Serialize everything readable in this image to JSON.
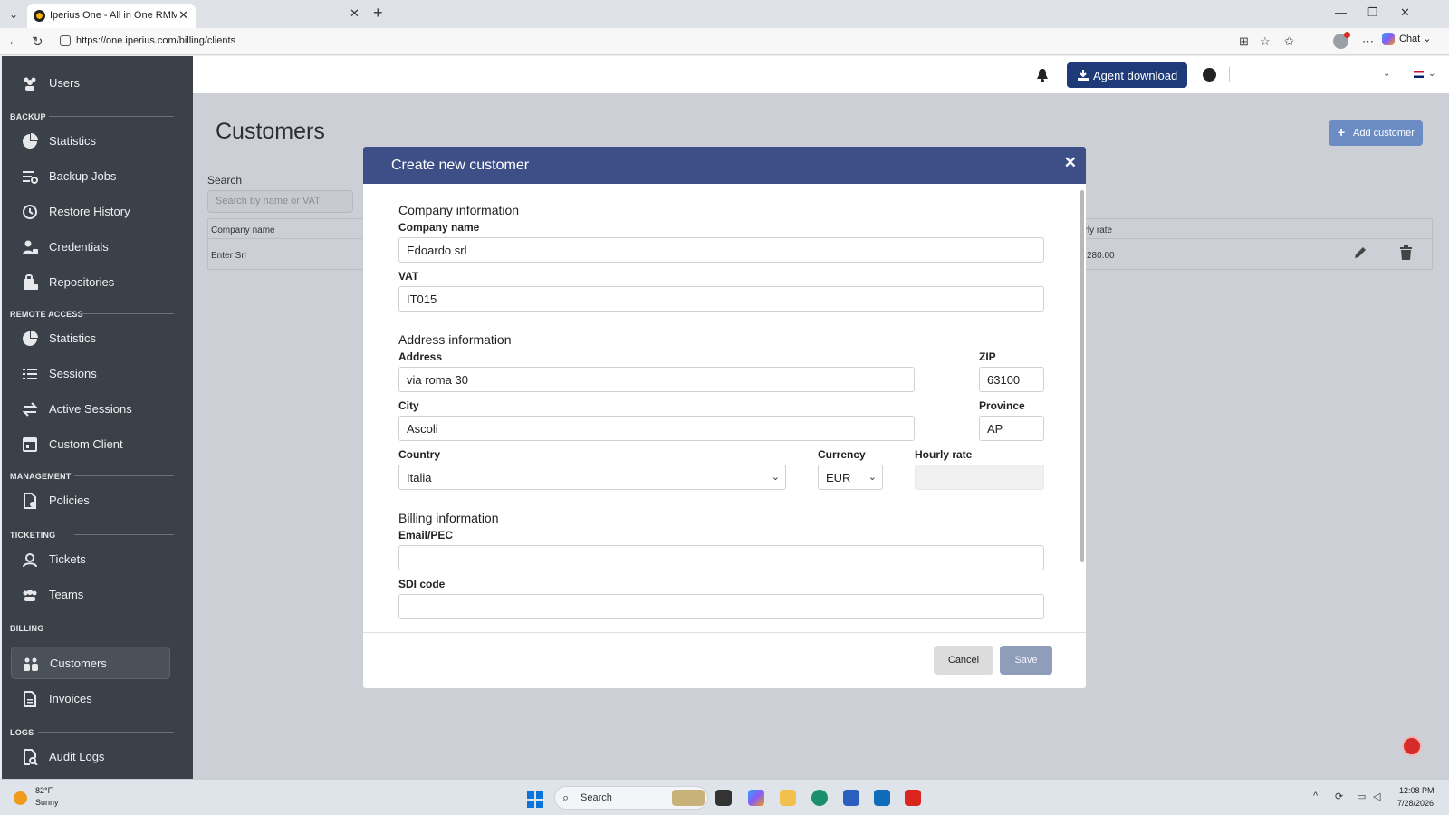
{
  "browser": {
    "tab_title": "Iperius One - All in One RMM Suite",
    "url": "https://one.iperius.com/billing/clients",
    "chat_label": "Chat"
  },
  "sidebar": {
    "items_top": [
      {
        "label": "Users",
        "icon": "users-icon"
      }
    ],
    "sections": [
      {
        "title": "BACKUP",
        "items": [
          {
            "label": "Statistics",
            "icon": "pie-chart-icon"
          },
          {
            "label": "Backup Jobs",
            "icon": "list-gear-icon"
          },
          {
            "label": "Restore History",
            "icon": "history-icon"
          },
          {
            "label": "Credentials",
            "icon": "user-lock-icon"
          },
          {
            "label": "Repositories",
            "icon": "folder-lock-icon"
          }
        ]
      },
      {
        "title": "REMOTE ACCESS",
        "items": [
          {
            "label": "Statistics",
            "icon": "pie-chart-icon"
          },
          {
            "label": "Sessions",
            "icon": "list-icon"
          },
          {
            "label": "Active Sessions",
            "icon": "arrows-exchange-icon"
          },
          {
            "label": "Custom Client",
            "icon": "window-icon"
          }
        ]
      },
      {
        "title": "MANAGEMENT",
        "items": [
          {
            "label": "Policies",
            "icon": "document-gear-icon"
          }
        ]
      },
      {
        "title": "TICKETING",
        "items": [
          {
            "label": "Tickets",
            "icon": "headset-icon"
          },
          {
            "label": "Teams",
            "icon": "team-icon"
          }
        ]
      },
      {
        "title": "BILLING",
        "items": [
          {
            "label": "Customers",
            "icon": "customers-icon"
          },
          {
            "label": "Invoices",
            "icon": "invoice-icon"
          }
        ]
      },
      {
        "title": "LOGS",
        "items": [
          {
            "label": "Audit Logs",
            "icon": "search-document-icon"
          }
        ]
      }
    ]
  },
  "topnav": {
    "agent_download": "Agent download"
  },
  "page": {
    "title": "Customers",
    "add_customer": "Add customer",
    "search_label": "Search",
    "search_placeholder": "Search by name or VAT",
    "table": {
      "headers": [
        "Company name",
        "urly rate"
      ],
      "rows": [
        [
          "Enter Srl",
          "280.00"
        ]
      ]
    }
  },
  "modal": {
    "title": "Create new customer",
    "company_section": "Company information",
    "company_name_label": "Company name",
    "company_name_value": "Edoardo srl",
    "vat_label": "VAT",
    "vat_value": "IT015",
    "address_section": "Address information",
    "address_label": "Address",
    "address_value": "via roma 30",
    "zip_label": "ZIP",
    "zip_value": "63100",
    "city_label": "City",
    "city_value": "Ascoli",
    "province_label": "Province",
    "province_value": "AP",
    "country_label": "Country",
    "country_value": "Italia",
    "currency_label": "Currency",
    "currency_value": "EUR",
    "hourly_rate_label": "Hourly rate",
    "hourly_rate_value": "",
    "billing_section": "Billing information",
    "email_label": "Email/PEC",
    "email_value": "",
    "sdi_label": "SDI code",
    "sdi_value": "",
    "cancel": "Cancel",
    "save": "Save"
  },
  "taskbar": {
    "temperature": "82°F",
    "condition": "Sunny",
    "search": "Search",
    "time": "12:08 PM",
    "date": "7/28/2026"
  },
  "colors": {
    "sidebar_bg": "#3a4149",
    "modal_header": "#3e4f88",
    "agent_button": "#1f3a78",
    "save_button": "#8f9dba"
  }
}
